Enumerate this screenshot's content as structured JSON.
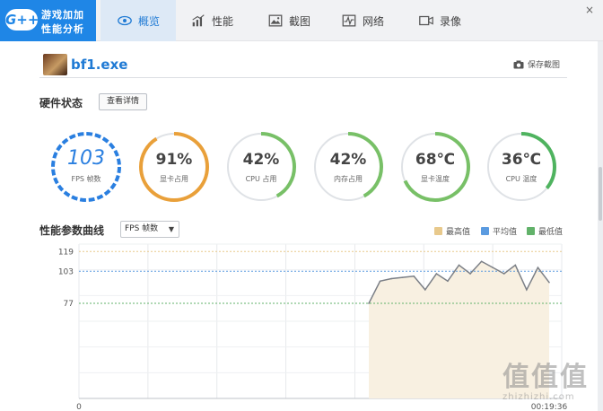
{
  "app": {
    "logo_badge": "G++",
    "logo_line1": "游戏加加",
    "logo_line2": "性能分析"
  },
  "tabs": [
    {
      "label": "概览",
      "icon": "eye-icon",
      "active": true
    },
    {
      "label": "性能",
      "icon": "bar-chart-icon",
      "active": false
    },
    {
      "label": "截图",
      "icon": "image-icon",
      "active": false
    },
    {
      "label": "网络",
      "icon": "pulse-icon",
      "active": false
    },
    {
      "label": "录像",
      "icon": "video-camera-icon",
      "active": false
    }
  ],
  "window_controls": {
    "close": "×"
  },
  "process": {
    "name": "bf1.exe",
    "save_label": "保存截图"
  },
  "hardware": {
    "title": "硬件状态",
    "detail_button": "查看详情",
    "gauges": [
      {
        "key": "fps",
        "value": "103",
        "label": "FPS 帧数",
        "fraction": 1.0,
        "color": "#2a7fe0"
      },
      {
        "key": "gpu_usage",
        "value": "91%",
        "label": "显卡占用",
        "fraction": 0.91,
        "color": "#e9a03a"
      },
      {
        "key": "cpu_usage",
        "value": "42%",
        "label": "CPU 占用",
        "fraction": 0.42,
        "color": "#78c067"
      },
      {
        "key": "mem_usage",
        "value": "42%",
        "label": "内存占用",
        "fraction": 0.42,
        "color": "#78c067"
      },
      {
        "key": "gpu_temp",
        "value": "68℃",
        "label": "显卡温度",
        "fraction": 0.68,
        "color": "#78c067"
      },
      {
        "key": "cpu_temp",
        "value": "36℃",
        "label": "CPU 温度",
        "fraction": 0.36,
        "color": "#4fb35f"
      }
    ]
  },
  "curve": {
    "title": "性能参数曲线",
    "select_value": "FPS 帧数",
    "legend": [
      {
        "label": "最高值",
        "color": "#e8c98c"
      },
      {
        "label": "平均值",
        "color": "#5b9be0"
      },
      {
        "label": "最低值",
        "color": "#62b26a"
      }
    ]
  },
  "chart_data": {
    "type": "line",
    "y_ticks": [
      "119",
      "103",
      "77"
    ],
    "reference_lines": {
      "max": 119,
      "avg": 103,
      "min": 77
    },
    "ylim": [
      0,
      125
    ],
    "x_start_label": "0",
    "x_end_label": "00:19:36",
    "series": [
      {
        "values": [
          77,
          95,
          97,
          98,
          99,
          88,
          101,
          95,
          108,
          101,
          111,
          106,
          101,
          108,
          88,
          106,
          94
        ]
      }
    ]
  },
  "watermark": {
    "big": "值值值",
    "small": "zhizhizhi.com"
  }
}
